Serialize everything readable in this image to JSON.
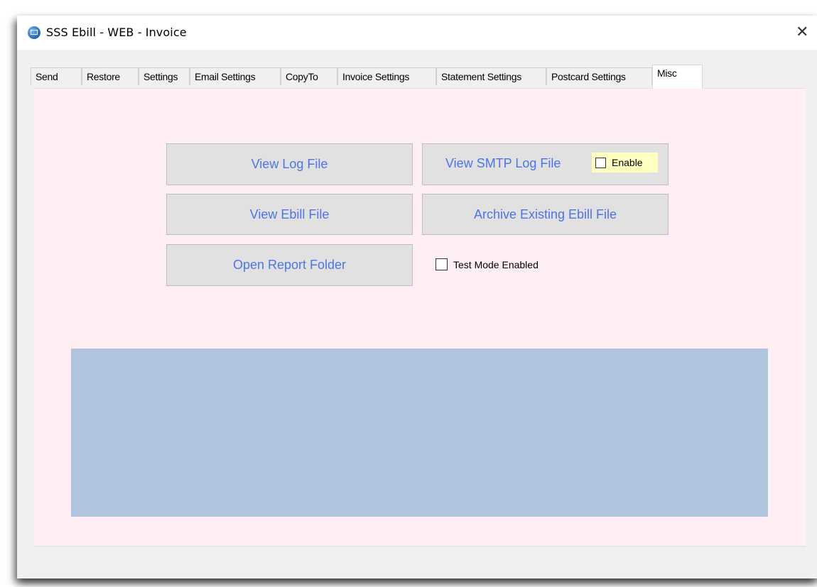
{
  "window": {
    "title": "SSS Ebill - WEB - Invoice",
    "close_glyph": "✕"
  },
  "tabs": [
    {
      "label": "Send"
    },
    {
      "label": "Restore"
    },
    {
      "label": "Settings"
    },
    {
      "label": "Email Settings"
    },
    {
      "label": "CopyTo"
    },
    {
      "label": "Invoice Settings"
    },
    {
      "label": "Statement Settings"
    },
    {
      "label": "Postcard Settings"
    },
    {
      "label": "Misc",
      "active": true
    }
  ],
  "misc": {
    "view_log_file": "View Log File",
    "view_smtp_log_file": "View SMTP Log File",
    "enable_label": "Enable",
    "enable_checked": false,
    "view_ebill_file": "View Ebill File",
    "archive_existing_ebill_file": "Archive Existing Ebill File",
    "open_report_folder": "Open Report Folder",
    "test_mode_label": "Test Mode Enabled",
    "test_mode_checked": false
  },
  "colors": {
    "panel_bg": "#ffeef2",
    "button_text": "#4e74e6",
    "output_area": "#b0c4de",
    "enable_highlight": "#ffffc0"
  }
}
